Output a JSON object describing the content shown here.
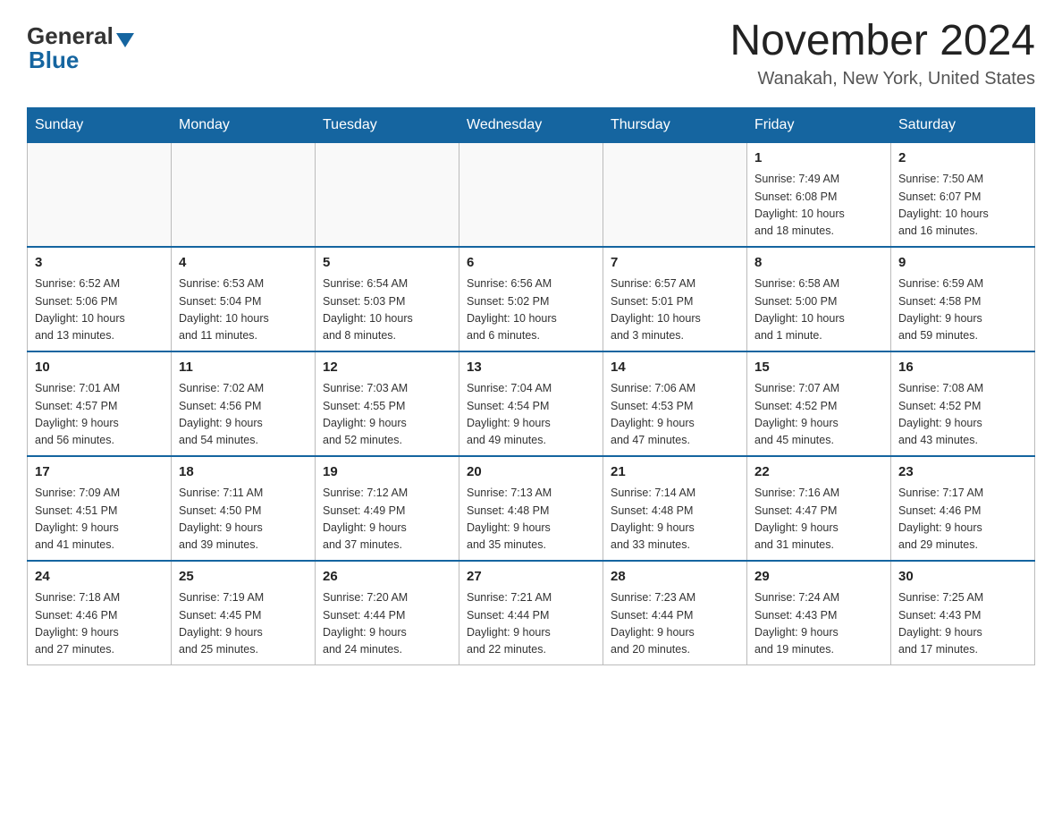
{
  "header": {
    "logo_main": "General",
    "logo_sub": "Blue",
    "month_title": "November 2024",
    "location": "Wanakah, New York, United States"
  },
  "days_of_week": [
    "Sunday",
    "Monday",
    "Tuesday",
    "Wednesday",
    "Thursday",
    "Friday",
    "Saturday"
  ],
  "weeks": [
    [
      {
        "day": "",
        "info": ""
      },
      {
        "day": "",
        "info": ""
      },
      {
        "day": "",
        "info": ""
      },
      {
        "day": "",
        "info": ""
      },
      {
        "day": "",
        "info": ""
      },
      {
        "day": "1",
        "info": "Sunrise: 7:49 AM\nSunset: 6:08 PM\nDaylight: 10 hours\nand 18 minutes."
      },
      {
        "day": "2",
        "info": "Sunrise: 7:50 AM\nSunset: 6:07 PM\nDaylight: 10 hours\nand 16 minutes."
      }
    ],
    [
      {
        "day": "3",
        "info": "Sunrise: 6:52 AM\nSunset: 5:06 PM\nDaylight: 10 hours\nand 13 minutes."
      },
      {
        "day": "4",
        "info": "Sunrise: 6:53 AM\nSunset: 5:04 PM\nDaylight: 10 hours\nand 11 minutes."
      },
      {
        "day": "5",
        "info": "Sunrise: 6:54 AM\nSunset: 5:03 PM\nDaylight: 10 hours\nand 8 minutes."
      },
      {
        "day": "6",
        "info": "Sunrise: 6:56 AM\nSunset: 5:02 PM\nDaylight: 10 hours\nand 6 minutes."
      },
      {
        "day": "7",
        "info": "Sunrise: 6:57 AM\nSunset: 5:01 PM\nDaylight: 10 hours\nand 3 minutes."
      },
      {
        "day": "8",
        "info": "Sunrise: 6:58 AM\nSunset: 5:00 PM\nDaylight: 10 hours\nand 1 minute."
      },
      {
        "day": "9",
        "info": "Sunrise: 6:59 AM\nSunset: 4:58 PM\nDaylight: 9 hours\nand 59 minutes."
      }
    ],
    [
      {
        "day": "10",
        "info": "Sunrise: 7:01 AM\nSunset: 4:57 PM\nDaylight: 9 hours\nand 56 minutes."
      },
      {
        "day": "11",
        "info": "Sunrise: 7:02 AM\nSunset: 4:56 PM\nDaylight: 9 hours\nand 54 minutes."
      },
      {
        "day": "12",
        "info": "Sunrise: 7:03 AM\nSunset: 4:55 PM\nDaylight: 9 hours\nand 52 minutes."
      },
      {
        "day": "13",
        "info": "Sunrise: 7:04 AM\nSunset: 4:54 PM\nDaylight: 9 hours\nand 49 minutes."
      },
      {
        "day": "14",
        "info": "Sunrise: 7:06 AM\nSunset: 4:53 PM\nDaylight: 9 hours\nand 47 minutes."
      },
      {
        "day": "15",
        "info": "Sunrise: 7:07 AM\nSunset: 4:52 PM\nDaylight: 9 hours\nand 45 minutes."
      },
      {
        "day": "16",
        "info": "Sunrise: 7:08 AM\nSunset: 4:52 PM\nDaylight: 9 hours\nand 43 minutes."
      }
    ],
    [
      {
        "day": "17",
        "info": "Sunrise: 7:09 AM\nSunset: 4:51 PM\nDaylight: 9 hours\nand 41 minutes."
      },
      {
        "day": "18",
        "info": "Sunrise: 7:11 AM\nSunset: 4:50 PM\nDaylight: 9 hours\nand 39 minutes."
      },
      {
        "day": "19",
        "info": "Sunrise: 7:12 AM\nSunset: 4:49 PM\nDaylight: 9 hours\nand 37 minutes."
      },
      {
        "day": "20",
        "info": "Sunrise: 7:13 AM\nSunset: 4:48 PM\nDaylight: 9 hours\nand 35 minutes."
      },
      {
        "day": "21",
        "info": "Sunrise: 7:14 AM\nSunset: 4:48 PM\nDaylight: 9 hours\nand 33 minutes."
      },
      {
        "day": "22",
        "info": "Sunrise: 7:16 AM\nSunset: 4:47 PM\nDaylight: 9 hours\nand 31 minutes."
      },
      {
        "day": "23",
        "info": "Sunrise: 7:17 AM\nSunset: 4:46 PM\nDaylight: 9 hours\nand 29 minutes."
      }
    ],
    [
      {
        "day": "24",
        "info": "Sunrise: 7:18 AM\nSunset: 4:46 PM\nDaylight: 9 hours\nand 27 minutes."
      },
      {
        "day": "25",
        "info": "Sunrise: 7:19 AM\nSunset: 4:45 PM\nDaylight: 9 hours\nand 25 minutes."
      },
      {
        "day": "26",
        "info": "Sunrise: 7:20 AM\nSunset: 4:44 PM\nDaylight: 9 hours\nand 24 minutes."
      },
      {
        "day": "27",
        "info": "Sunrise: 7:21 AM\nSunset: 4:44 PM\nDaylight: 9 hours\nand 22 minutes."
      },
      {
        "day": "28",
        "info": "Sunrise: 7:23 AM\nSunset: 4:44 PM\nDaylight: 9 hours\nand 20 minutes."
      },
      {
        "day": "29",
        "info": "Sunrise: 7:24 AM\nSunset: 4:43 PM\nDaylight: 9 hours\nand 19 minutes."
      },
      {
        "day": "30",
        "info": "Sunrise: 7:25 AM\nSunset: 4:43 PM\nDaylight: 9 hours\nand 17 minutes."
      }
    ]
  ]
}
